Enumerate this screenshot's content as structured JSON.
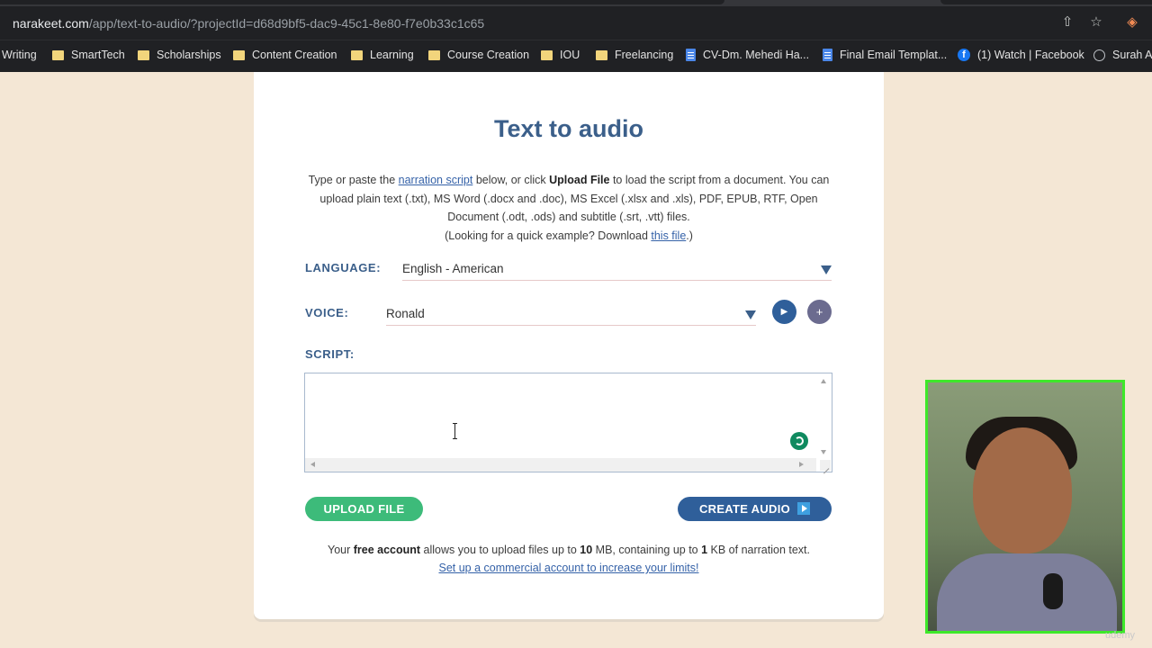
{
  "browser": {
    "url_host": "narakeet.com",
    "url_path": "/app/text-to-audio/?projectId=d68d9bf5-dac9-45c1-8e80-f7e0b33c1c65",
    "bookmarks": [
      {
        "label": "Writing",
        "icon": "none"
      },
      {
        "label": "SmartTech",
        "icon": "folder-icon"
      },
      {
        "label": "Scholarships",
        "icon": "folder-icon"
      },
      {
        "label": "Content Creation",
        "icon": "folder-icon"
      },
      {
        "label": "Learning",
        "icon": "folder-icon"
      },
      {
        "label": "Course Creation",
        "icon": "folder-icon"
      },
      {
        "label": "IOU",
        "icon": "folder-icon"
      },
      {
        "label": "Freelancing",
        "icon": "folder-icon"
      },
      {
        "label": "CV-Dm. Mehedi Ha...",
        "icon": "doc-icon"
      },
      {
        "label": "Final Email Templat...",
        "icon": "doc-icon"
      },
      {
        "label": "(1) Watch | Facebook",
        "icon": "facebook-icon"
      },
      {
        "label": "Surah A",
        "icon": "globe-icon"
      }
    ]
  },
  "page": {
    "title": "Text to audio",
    "intro_pre": "Type or paste the ",
    "intro_link1": "narration script",
    "intro_mid": " below, or click ",
    "intro_bold": "Upload File",
    "intro_rest": " to load the script from a document. You can upload plain text (.txt), MS Word (.docx and .doc), MS Excel (.xlsx and .xls), PDF, EPUB, RTF, Open Document (.odt, .ods) and subtitle (.srt, .vtt) files.",
    "intro_example_pre": "(Looking for a quick example? Download ",
    "intro_example_link": "this file",
    "intro_example_post": ".)",
    "language_label": "LANGUAGE:",
    "language_value": "English - American",
    "voice_label": "VOICE:",
    "voice_value": "Ronald",
    "script_label": "SCRIPT:",
    "script_value": "",
    "upload_button": "UPLOAD FILE",
    "create_button": "CREATE AUDIO",
    "limits_pre": "Your ",
    "limits_bold1": "free account",
    "limits_mid1": " allows you to upload files up to ",
    "limits_bold2": "10",
    "limits_mid2": " MB, containing up to ",
    "limits_bold3": "1",
    "limits_mid3": " KB of narration text.",
    "limits_link": "Set up a commercial account to increase your limits!"
  },
  "overlay": {
    "watermark": "udemy"
  },
  "colors": {
    "background": "#f4e7d5",
    "brand_blue": "#3b5f8a",
    "upload_green": "#3dbb7a",
    "create_blue": "#2f5f9a",
    "webcam_border": "#3ee82a"
  }
}
